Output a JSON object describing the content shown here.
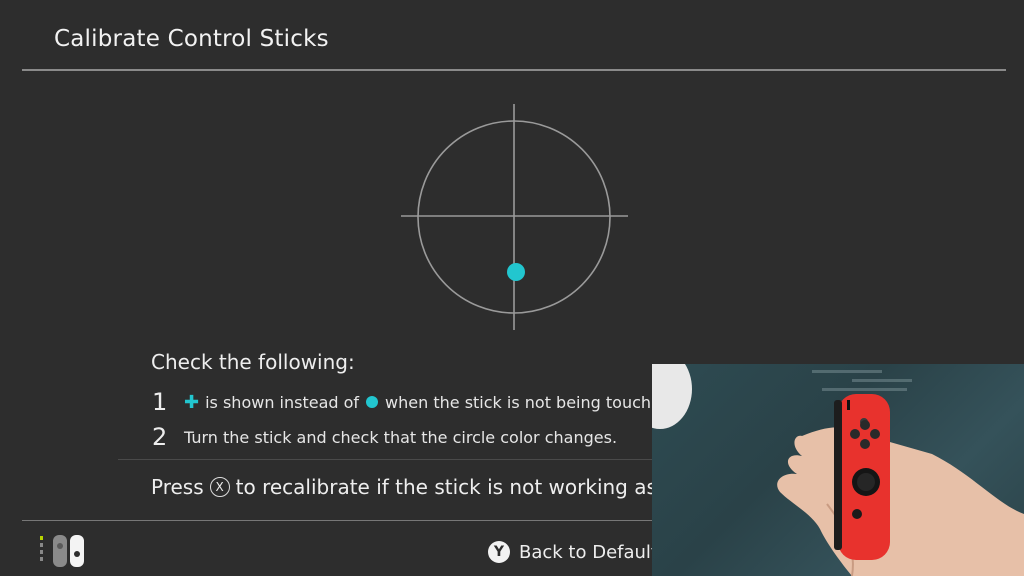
{
  "header": {
    "title": "Calibrate Control Sticks"
  },
  "stick_indicator": {
    "color": "#22c6cf"
  },
  "instructions": {
    "heading": "Check the following:",
    "step1": {
      "number": "1",
      "marker_icon": "plus-icon",
      "text_a": "is shown instead of",
      "dot_icon": "dot-icon",
      "text_b": "when the stick is not being touch"
    },
    "step2": {
      "number": "2",
      "text": "Turn the stick and check that the circle color changes."
    }
  },
  "recalibrate": {
    "text_a": "Press",
    "button_glyph": "X",
    "text_b": "to recalibrate if the stick is not working as c"
  },
  "footer": {
    "controller_icon": "joycon-icon",
    "back_button": {
      "glyph": "Y",
      "label": "Back to Default"
    }
  },
  "camera_inset": {
    "description_icon": "hand-holding-red-joycon"
  }
}
